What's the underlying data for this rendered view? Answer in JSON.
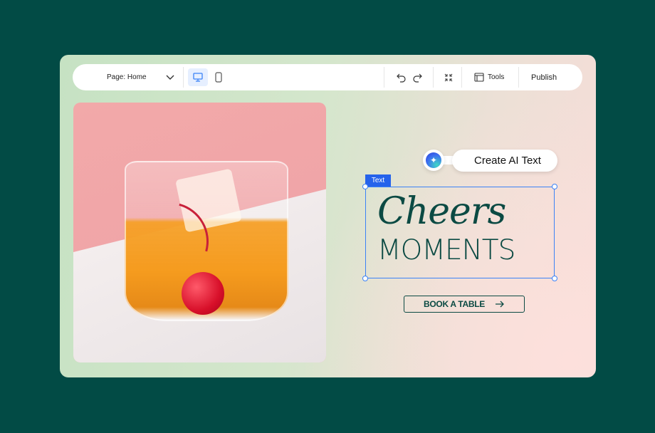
{
  "toolbar": {
    "page_selector": "Page: Home",
    "tools_label": "Tools",
    "publish_label": "Publish",
    "active_view": "desktop"
  },
  "editor": {
    "ai_button": "Create AI Text",
    "selection_label": "Text",
    "heading_script": "Cheers",
    "heading_caps": "MOMENTS",
    "cta_label": "BOOK A TABLE",
    "accent": "#3b82f6",
    "text_color": "#0b4a43"
  }
}
